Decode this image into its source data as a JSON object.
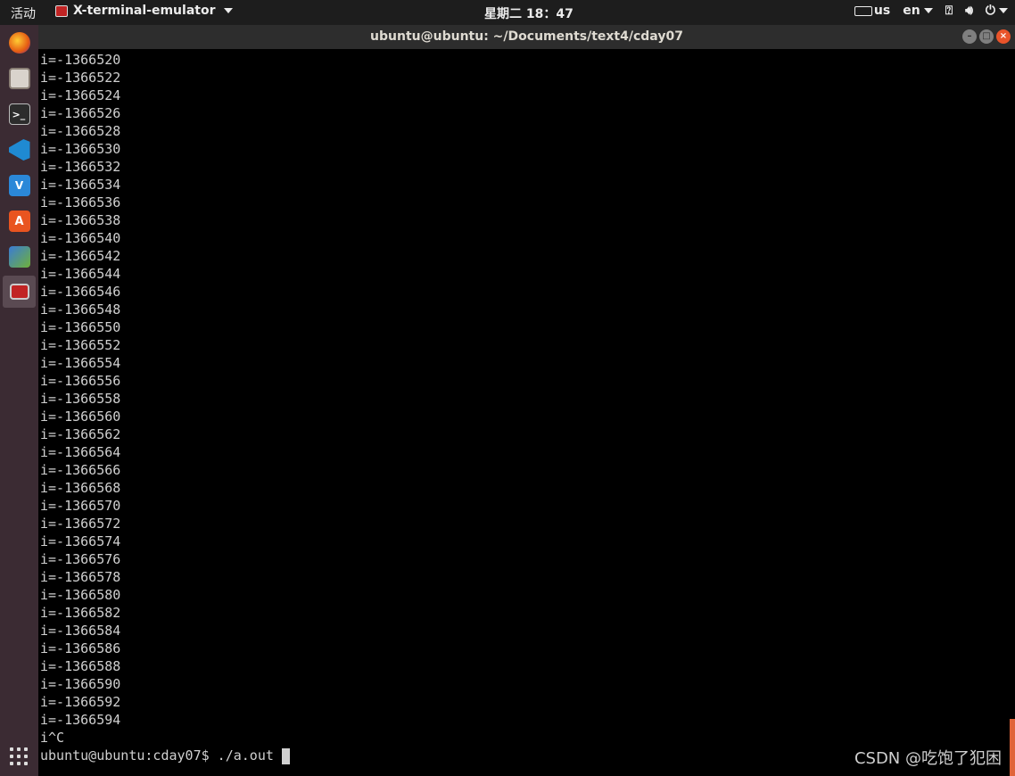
{
  "top_panel": {
    "activities": "活动",
    "app_menu_label": "X-terminal-emulator",
    "clock": "星期二 18：47",
    "keyboard_layout": "us",
    "language": "en"
  },
  "dock": {
    "items": [
      "firefox-icon",
      "files-icon",
      "terminal-icon",
      "vscode-icon",
      "vnc-icon",
      "software-center-icon",
      "network-icon",
      "x-terminal-icon"
    ],
    "active_index": 7
  },
  "window": {
    "title": "ubuntu@ubuntu: ~/Documents/text4/cday07",
    "buttons": [
      "minimize",
      "maximize",
      "close"
    ]
  },
  "terminal": {
    "output_lines": [
      "i=-1366520",
      "i=-1366522",
      "i=-1366524",
      "i=-1366526",
      "i=-1366528",
      "i=-1366530",
      "i=-1366532",
      "i=-1366534",
      "i=-1366536",
      "i=-1366538",
      "i=-1366540",
      "i=-1366542",
      "i=-1366544",
      "i=-1366546",
      "i=-1366548",
      "i=-1366550",
      "i=-1366552",
      "i=-1366554",
      "i=-1366556",
      "i=-1366558",
      "i=-1366560",
      "i=-1366562",
      "i=-1366564",
      "i=-1366566",
      "i=-1366568",
      "i=-1366570",
      "i=-1366572",
      "i=-1366574",
      "i=-1366576",
      "i=-1366578",
      "i=-1366580",
      "i=-1366582",
      "i=-1366584",
      "i=-1366586",
      "i=-1366588",
      "i=-1366590",
      "i=-1366592",
      "i=-1366594",
      "i^C"
    ],
    "prompt": "ubuntu@ubuntu:cday07$ ./a.out "
  },
  "watermark": "CSDN @吃饱了犯困",
  "colors": {
    "panel_bg": "#1d1d1d",
    "dock_bg": "#3b2b33",
    "titlebar_bg": "#2d2d2d",
    "terminal_bg": "#000000",
    "terminal_fg": "#d0d0d0",
    "close_button": "#e9542a"
  }
}
